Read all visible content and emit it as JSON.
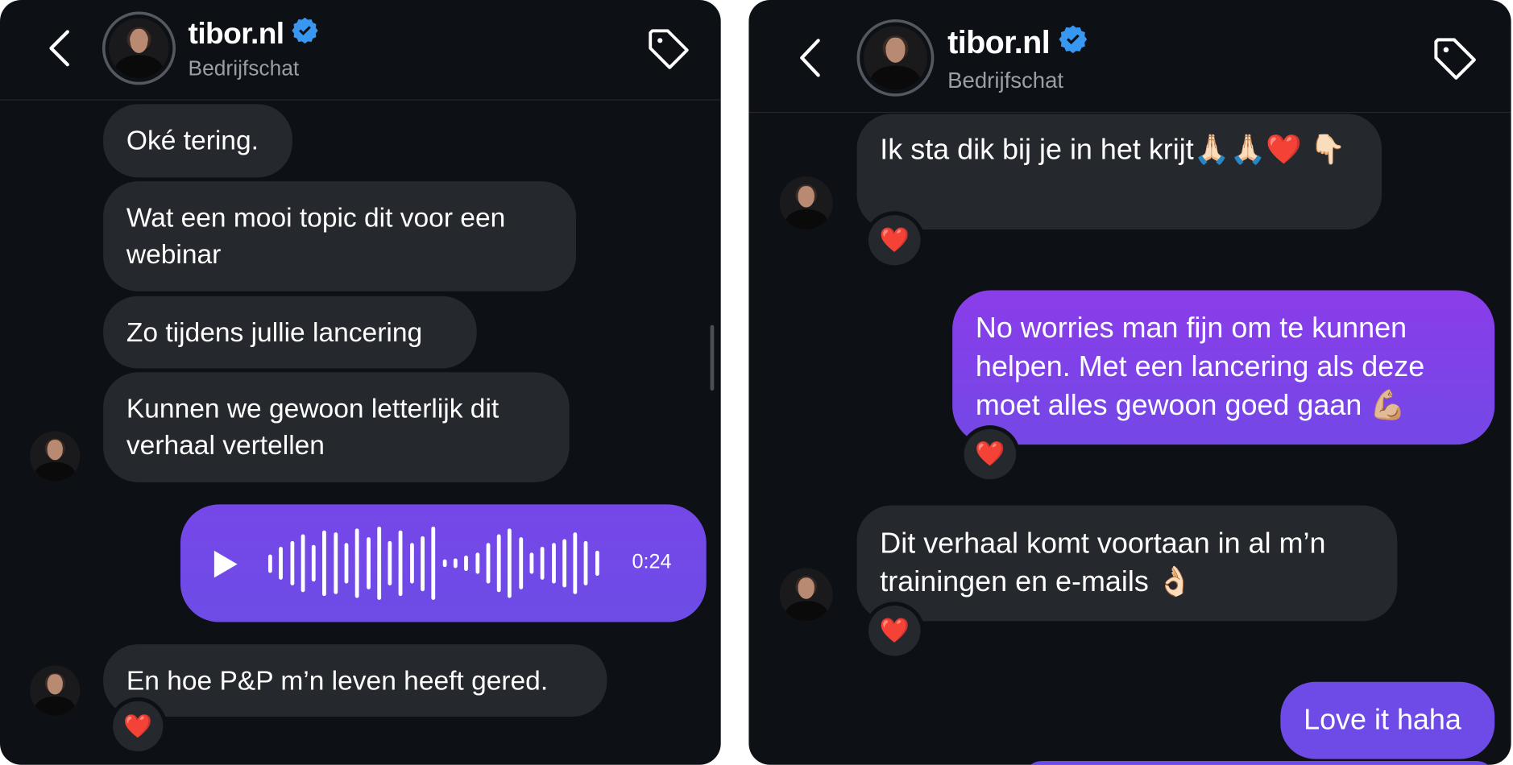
{
  "colors": {
    "background": "#0d1015",
    "incoming_bubble": "#25282d",
    "outgoing_bubble": "#7a45e7",
    "verified": "#3897f0"
  },
  "left": {
    "header": {
      "name": "tibor.nl",
      "subtitle": "Bedrijfschat",
      "verified": true
    },
    "messages": [
      {
        "text": "Oké tering."
      },
      {
        "text": "Wat een mooi topic dit voor een webinar"
      },
      {
        "text": "Zo tijdens jullie lancering"
      },
      {
        "text": "Kunnen we gewoon letterlijk dit verhaal vertellen"
      },
      {
        "type": "voice",
        "duration": "0:24",
        "waveform": [
          0.25,
          0.45,
          0.6,
          0.8,
          0.5,
          0.9,
          0.85,
          0.55,
          0.95,
          0.7,
          1.0,
          0.6,
          0.9,
          0.55,
          0.75,
          1.0,
          0.1,
          0.12,
          0.2,
          0.3,
          0.55,
          0.8,
          0.95,
          0.7,
          0.3,
          0.45,
          0.55,
          0.65,
          0.85,
          0.6,
          0.35
        ],
        "reaction": ""
      },
      {
        "text": "En hoe P&P m’n leven heeft gered.",
        "reaction": "❤️"
      }
    ]
  },
  "right": {
    "header": {
      "name": "tibor.nl",
      "subtitle": "Bedrijfschat",
      "verified": true
    },
    "messages": [
      {
        "text": "Ik sta dik bij je in het krijt🙏🏻🙏🏻❤️ 👇🏻",
        "reaction": "❤️"
      },
      {
        "text": "No worries man fijn om te kunnen helpen. Met een lancering als deze moet alles gewoon goed gaan 💪🏼",
        "reaction": "❤️"
      },
      {
        "text": "Dit verhaal komt voortaan in al m’n trainingen en e-mails 👌🏻",
        "reaction": "❤️"
      },
      {
        "text": "Love it haha"
      }
    ]
  }
}
